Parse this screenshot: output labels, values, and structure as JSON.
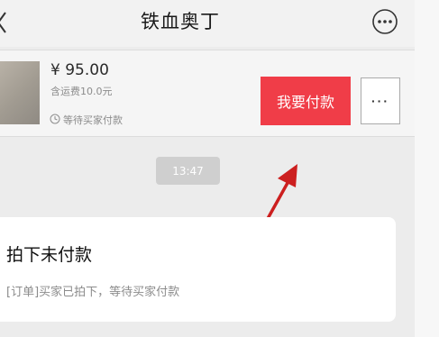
{
  "header": {
    "title": "铁血奥丁",
    "back_icon": "chevron-left-icon",
    "more_icon": "more-circle-icon"
  },
  "order": {
    "price": "¥ 95.00",
    "shipping": "含运费10.0元",
    "status_icon": "clock-icon",
    "status": "等待买家付款",
    "pay_button": "我要付款",
    "more_button": "···"
  },
  "timeline": {
    "time": "13:47"
  },
  "message": {
    "title": "拍下未付款",
    "body": "[订单]买家已拍下，等待买家付款"
  },
  "colors": {
    "pay_button": "#f03d48",
    "annotation_arrow": "#cc1f1f"
  }
}
